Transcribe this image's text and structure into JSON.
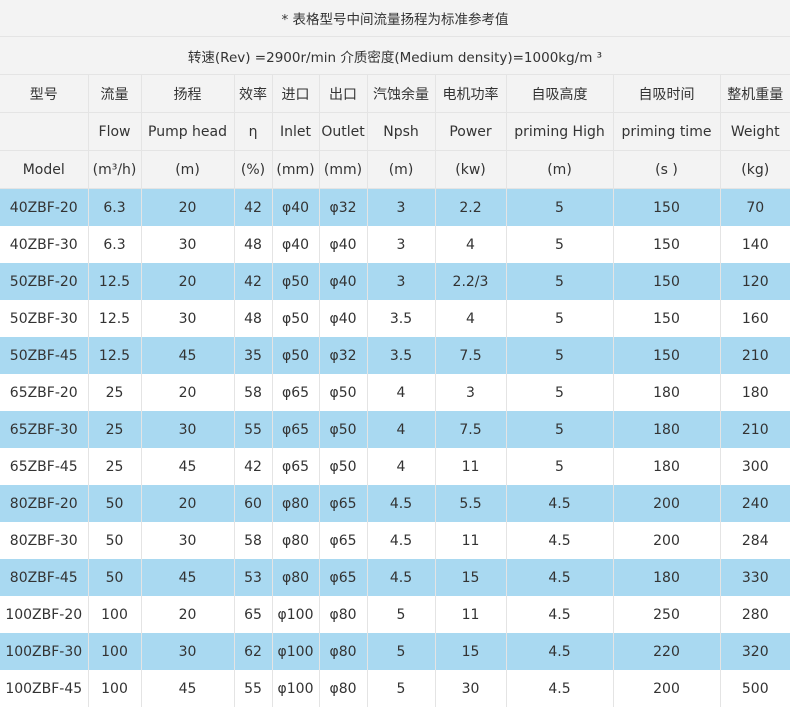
{
  "note": "* 表格型号中间流量扬程为标准参考值",
  "conditions": "转速(Rev) =2900r/min   介质密度(Medium density)=1000kg/m ³",
  "header_cn": [
    "型号",
    "流量",
    "扬程",
    "效率",
    "进口",
    "出口",
    "汽蚀余量",
    "电机功率",
    "自吸高度",
    "自吸时间",
    "整机重量"
  ],
  "header_en": [
    "",
    "Flow",
    "Pump head",
    "η",
    "Inlet",
    "Outlet",
    "Npsh",
    "Power",
    "priming High",
    "priming time",
    "Weight"
  ],
  "header_unit": [
    "Model",
    "(m³/h)",
    "(m)",
    "(%)",
    "(mm)",
    "(mm)",
    "(m)",
    "(kw)",
    "(m)",
    "(s )",
    "(kg)"
  ],
  "rows": [
    [
      "40ZBF-20",
      "6.3",
      "20",
      "42",
      "φ40",
      "φ32",
      "3",
      "2.2",
      "5",
      "150",
      "70"
    ],
    [
      "40ZBF-30",
      "6.3",
      "30",
      "48",
      "φ40",
      "φ40",
      "3",
      "4",
      "5",
      "150",
      "140"
    ],
    [
      "50ZBF-20",
      "12.5",
      "20",
      "42",
      "φ50",
      "φ40",
      "3",
      "2.2/3",
      "5",
      "150",
      "120"
    ],
    [
      "50ZBF-30",
      "12.5",
      "30",
      "48",
      "φ50",
      "φ40",
      "3.5",
      "4",
      "5",
      "150",
      "160"
    ],
    [
      "50ZBF-45",
      "12.5",
      "45",
      "35",
      "φ50",
      "φ32",
      "3.5",
      "7.5",
      "5",
      "150",
      "210"
    ],
    [
      "65ZBF-20",
      "25",
      "20",
      "58",
      "φ65",
      "φ50",
      "4",
      "3",
      "5",
      "180",
      "180"
    ],
    [
      "65ZBF-30",
      "25",
      "30",
      "55",
      "φ65",
      "φ50",
      "4",
      "7.5",
      "5",
      "180",
      "210"
    ],
    [
      "65ZBF-45",
      "25",
      "45",
      "42",
      "φ65",
      "φ50",
      "4",
      "11",
      "5",
      "180",
      "300"
    ],
    [
      "80ZBF-20",
      "50",
      "20",
      "60",
      "φ80",
      "φ65",
      "4.5",
      "5.5",
      "4.5",
      "200",
      "240"
    ],
    [
      "80ZBF-30",
      "50",
      "30",
      "58",
      "φ80",
      "φ65",
      "4.5",
      "11",
      "4.5",
      "200",
      "284"
    ],
    [
      "80ZBF-45",
      "50",
      "45",
      "53",
      "φ80",
      "φ65",
      "4.5",
      "15",
      "4.5",
      "180",
      "330"
    ],
    [
      "100ZBF-20",
      "100",
      "20",
      "65",
      "φ100",
      "φ80",
      "5",
      "11",
      "4.5",
      "250",
      "280"
    ],
    [
      "100ZBF-30",
      "100",
      "30",
      "62",
      "φ100",
      "φ80",
      "5",
      "15",
      "4.5",
      "220",
      "320"
    ],
    [
      "100ZBF-45",
      "100",
      "45",
      "55",
      "φ100",
      "φ80",
      "5",
      "30",
      "4.5",
      "200",
      "500"
    ]
  ],
  "colors": {
    "header_bg": "#f3f3f3",
    "stripe_bg": "#a9d9f1",
    "plain_bg": "#ffffff",
    "grid": "#e4e4e4",
    "text": "#333333"
  }
}
